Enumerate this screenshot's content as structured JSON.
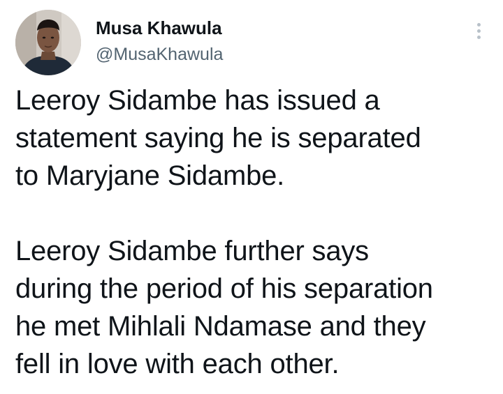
{
  "tweet": {
    "author": {
      "display_name": "Musa Khawula",
      "handle": "@MusaKhawula",
      "avatar": "profile-photo"
    },
    "more_icon": "more-vertical-icon",
    "body": {
      "paragraphs": [
        {
          "lines": [
            "Leeroy Sidambe has issued a",
            "statement saying he is separated",
            "to Maryjane Sidambe."
          ]
        },
        {
          "lines": [
            "Leeroy Sidambe further says",
            "during the period of his separation",
            "he met Mihlali Ndamase and they",
            "fell in love with each other."
          ]
        }
      ]
    }
  }
}
